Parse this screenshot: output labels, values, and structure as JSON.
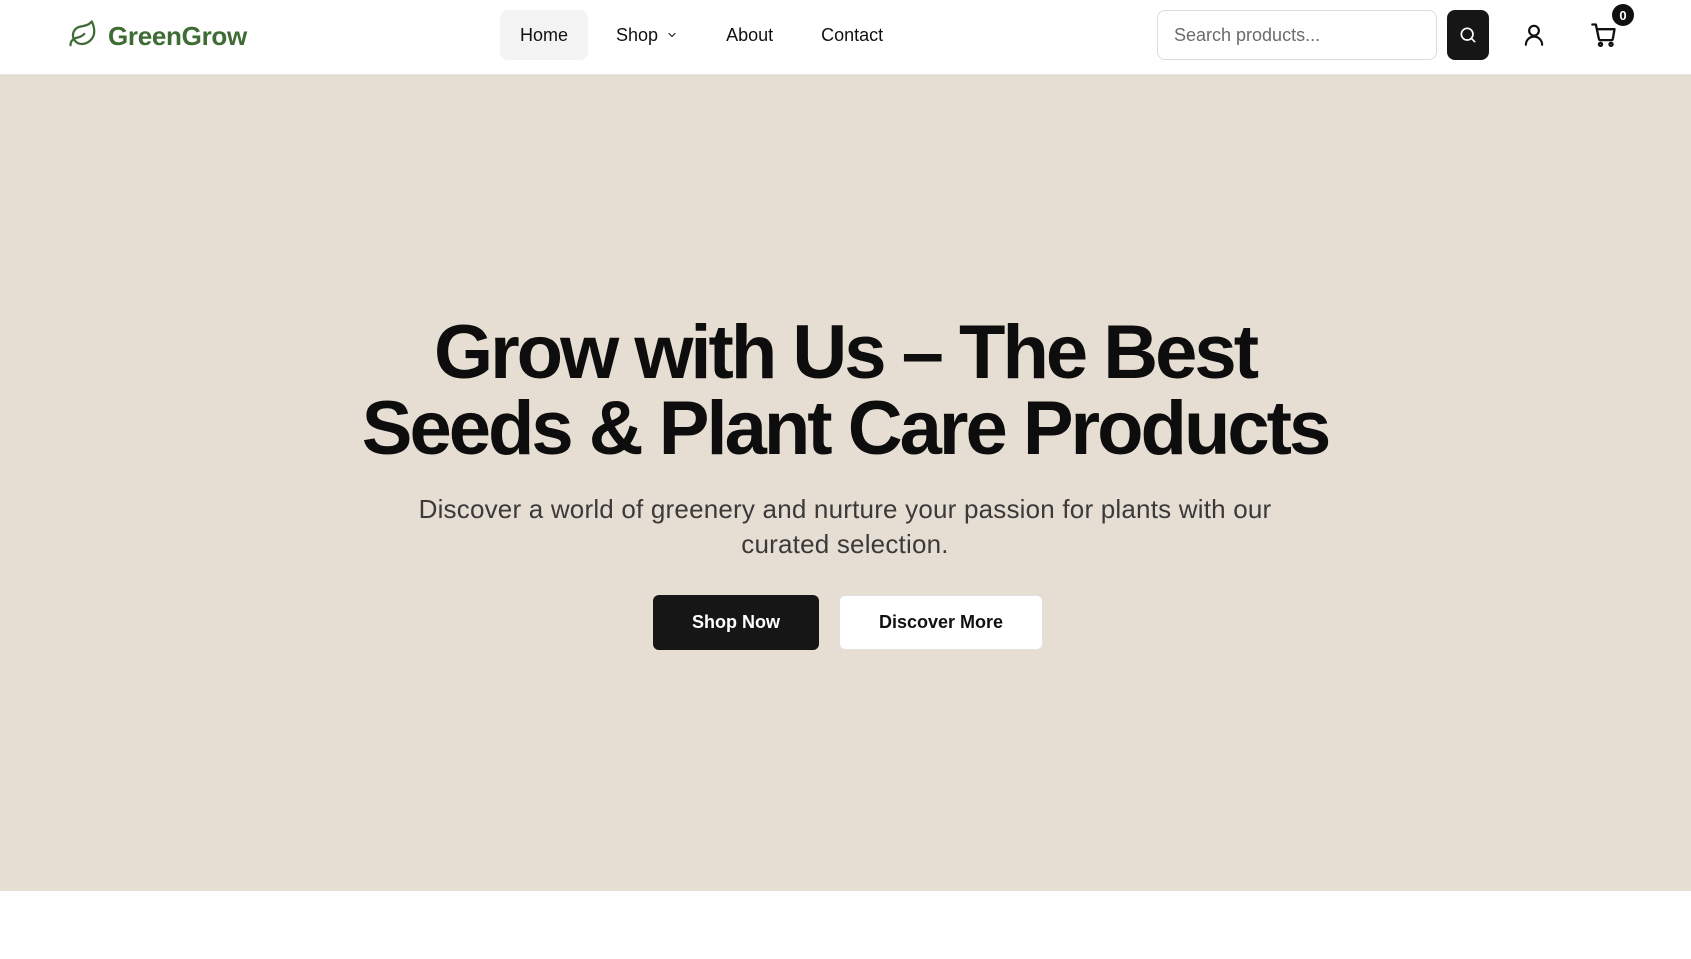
{
  "header": {
    "brand": "GreenGrow",
    "brand_color": "#3f6b35",
    "nav": [
      {
        "label": "Home",
        "active": true
      },
      {
        "label": "Shop",
        "has_dropdown": true
      },
      {
        "label": "About"
      },
      {
        "label": "Contact"
      }
    ],
    "search": {
      "placeholder": "Search products...",
      "value": ""
    },
    "icons": [
      "leaf-icon",
      "chevron-down-icon",
      "search-icon",
      "user-icon",
      "cart-icon"
    ],
    "cart_count": "0"
  },
  "hero": {
    "background": "#e7ded3",
    "title_line1": "Grow with Us – The Best",
    "title_line2": "Seeds & Plant Care Products",
    "subtitle": "Discover a world of greenery and nurture your passion for plants with our curated selection.",
    "primary_cta": "Shop Now",
    "secondary_cta": "Discover More"
  }
}
